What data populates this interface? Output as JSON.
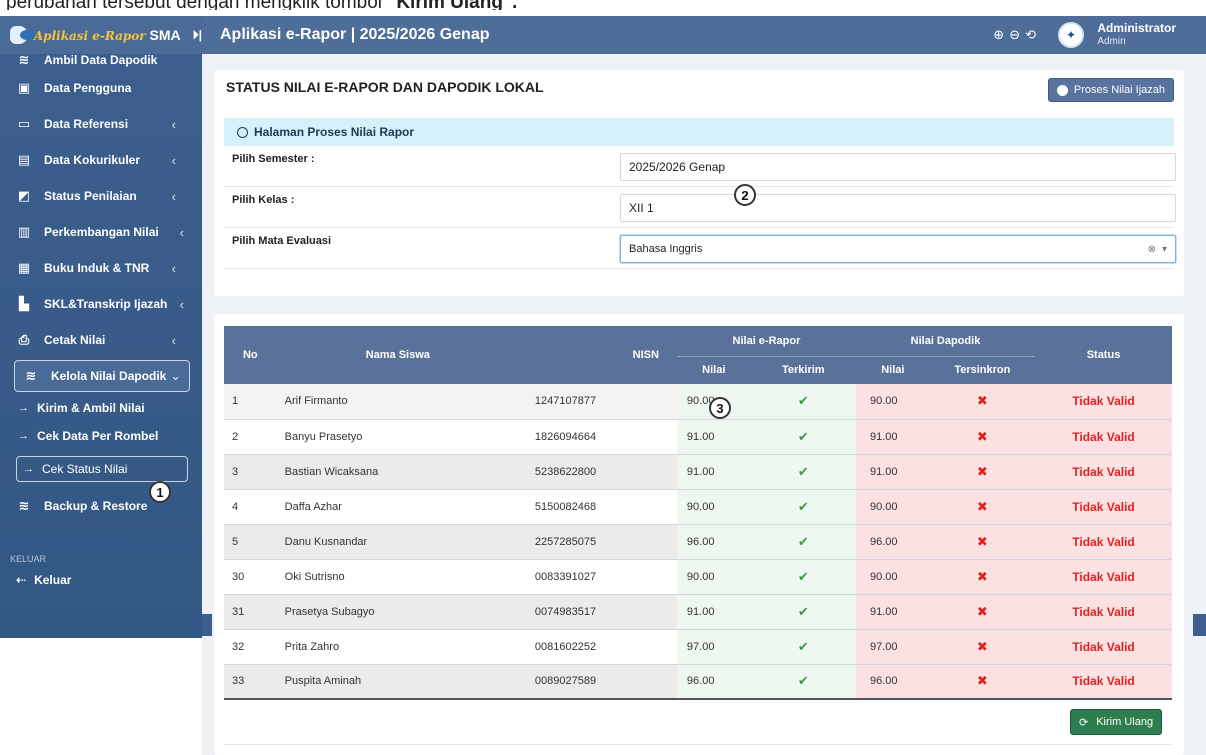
{
  "caption": {
    "pre": "perubahan tersebut dengan mengklik tombol ",
    "bold": "\"Kirim Ulang\"",
    "post": "."
  },
  "brand": {
    "part1": "Aplikasi e-Rapor",
    "part2": " SMA",
    "toggle": "⏵|"
  },
  "sidebar": {
    "items": [
      {
        "label": "Ambil Data Dapodik",
        "icon": "database-icon"
      },
      {
        "label": "Data Pengguna",
        "icon": "users-icon"
      },
      {
        "label": "Data Referensi",
        "icon": "monitor-icon",
        "chevron": "‹"
      },
      {
        "label": "Data Kokurikuler",
        "icon": "tablet-icon",
        "chevron": "‹"
      },
      {
        "label": "Status Penilaian",
        "icon": "chart-icon",
        "chevron": "‹"
      },
      {
        "label": "Perkembangan Nilai",
        "icon": "bar-chart-icon",
        "chevron": "‹"
      },
      {
        "label": "Buku Induk & TNR",
        "icon": "book-icon",
        "chevron": "‹"
      },
      {
        "label": "SKL&Transkrip Ijazah",
        "icon": "file-icon",
        "chevron": "‹"
      },
      {
        "label": "Cetak Nilai",
        "icon": "print-icon",
        "chevron": "‹"
      },
      {
        "label": "Kelola Nilai Dapodik",
        "icon": "database-icon",
        "chevron": "⌄"
      }
    ],
    "sub_items": [
      "Kirim & Ambil Nilai",
      "Cek Data Per Rombel",
      "Cek Status Nilai"
    ],
    "backup": "Backup & Restore",
    "section": "KELUAR",
    "logout": "Keluar"
  },
  "header": {
    "title": "Aplikasi e-Rapor | 2025/2026 Genap",
    "user_name": "Administrator",
    "user_role": "Admin"
  },
  "badges": {
    "b1": "1",
    "b2": "2",
    "b3": "3"
  },
  "form": {
    "card_title": "STATUS NILAI E-RAPOR DAN DAPODIK LOKAL",
    "btn_ijazah": "Proses Nilai Ijazah",
    "info": "Halaman Proses Nilai Rapor",
    "semester_label": "Pilih Semester :",
    "semester_value": "2025/2026 Genap",
    "kelas_label": "Pilih Kelas :",
    "kelas_value": "XII 1",
    "mapel_label": "Pilih Mata Evaluasi",
    "mapel_value": "Bahasa Inggris"
  },
  "table": {
    "headers": {
      "no": "No",
      "nama": "Nama Siswa",
      "nisn": "NISN",
      "erapor": "Nilai e-Rapor",
      "dapodik": "Nilai Dapodik",
      "status": "Status",
      "nilai": "Nilai",
      "terkirim": "Terkirim",
      "dnilai": "Nilai",
      "tersinkron": "Tersinkron"
    },
    "rows": [
      {
        "no": "1",
        "nama": "Arif Firmanto",
        "nisn": "1247107877",
        "nilai": "90.00",
        "terkirim": "✔",
        "dnilai": "90.00",
        "tersinkron": "✖",
        "status": "Tidak Valid"
      },
      {
        "no": "2",
        "nama": "Banyu Prasetyo",
        "nisn": "1826094664",
        "nilai": "91.00",
        "terkirim": "✔",
        "dnilai": "91.00",
        "tersinkron": "✖",
        "status": "Tidak Valid"
      },
      {
        "no": "3",
        "nama": "Bastian Wicaksana",
        "nisn": "5238622800",
        "nilai": "91.00",
        "terkirim": "✔",
        "dnilai": "91.00",
        "tersinkron": "✖",
        "status": "Tidak Valid"
      },
      {
        "no": "4",
        "nama": "Daffa Azhar",
        "nisn": "5150082468",
        "nilai": "90.00",
        "terkirim": "✔",
        "dnilai": "90.00",
        "tersinkron": "✖",
        "status": "Tidak Valid"
      },
      {
        "no": "5",
        "nama": "Danu Kusnandar",
        "nisn": "2257285075",
        "nilai": "96.00",
        "terkirim": "✔",
        "dnilai": "96.00",
        "tersinkron": "✖",
        "status": "Tidak Valid"
      },
      {
        "no": "30",
        "nama": "Oki Sutrisno",
        "nisn": "0083391027",
        "nilai": "90.00",
        "terkirim": "✔",
        "dnilai": "90.00",
        "tersinkron": "✖",
        "status": "Tidak Valid"
      },
      {
        "no": "31",
        "nama": "Prasetya Subagyo",
        "nisn": "0074983517",
        "nilai": "91.00",
        "terkirim": "✔",
        "dnilai": "91.00",
        "tersinkron": "✖",
        "status": "Tidak Valid"
      },
      {
        "no": "32",
        "nama": "Prita Zahro",
        "nisn": "0081602252",
        "nilai": "97.00",
        "terkirim": "✔",
        "dnilai": "97.00",
        "tersinkron": "✖",
        "status": "Tidak Valid"
      },
      {
        "no": "33",
        "nama": "Puspita Aminah",
        "nisn": "0089027589",
        "nilai": "96.00",
        "terkirim": "✔",
        "dnilai": "96.00",
        "tersinkron": "✖",
        "status": "Tidak Valid"
      }
    ],
    "btn_kirim": "Kirim Ulang"
  },
  "colors": {
    "sidebar": "#3d5f8f",
    "header": "#4f6d99",
    "table_head": "#5a7299",
    "status": "#e02222",
    "check": "#3b9a46",
    "kirim_btn": "#2e7d4f"
  }
}
